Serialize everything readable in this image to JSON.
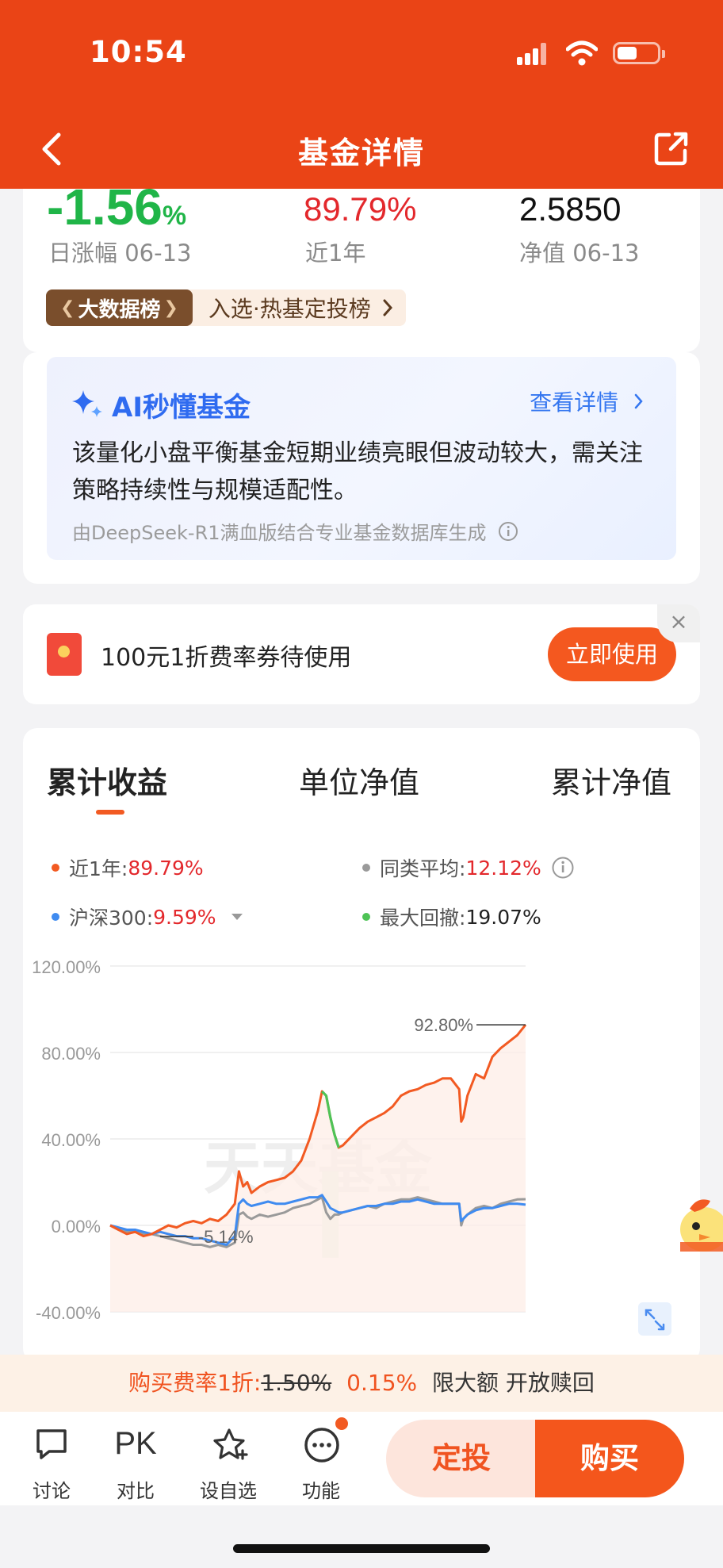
{
  "status_bar": {
    "time": "10:54"
  },
  "header": {
    "title": "基金详情"
  },
  "summary": {
    "daily_change": {
      "value": "-1.56",
      "unit": "%",
      "label": "日涨幅 06-13"
    },
    "one_year": {
      "value": "89.79%",
      "label": "近1年"
    },
    "nav": {
      "value": "2.5850",
      "label": "净值 06-13"
    },
    "rank_tag": "大数据榜",
    "rank_text": "入选·热基定投榜"
  },
  "ai": {
    "title": "AI秒懂基金",
    "more": "查看详情",
    "text": "该量化小盘平衡基金短期业绩亮眼但波动较大，需关注策略持续性与规模适配性。",
    "source": "由DeepSeek-R1满血版结合专业基金数据库生成"
  },
  "coupon": {
    "text": "100元1折费率券待使用",
    "button": "立即使用",
    "close": "×"
  },
  "tabs": [
    {
      "label": "累计收益"
    },
    {
      "label": "单位净值"
    },
    {
      "label": "累计净值"
    }
  ],
  "legend": {
    "fund": {
      "label": "近1年:",
      "value": "89.79%"
    },
    "category_avg": {
      "label": "同类平均:",
      "value": "12.12%"
    },
    "index": {
      "label": "沪深300:",
      "value": "9.59%"
    },
    "max_drawdown": {
      "label": "最大回撤:",
      "value": "19.07%"
    }
  },
  "chart_data": {
    "type": "line",
    "y_ticks": [
      "120.00%",
      "80.00%",
      "40.00%",
      "0.00%",
      "-40.00%"
    ],
    "ylim": [
      -40,
      120
    ],
    "annotations": {
      "max": "92.80%",
      "min": "-5.14%"
    },
    "watermark": "天天基金",
    "x": [
      0,
      2,
      4,
      6,
      8,
      10,
      12,
      14,
      16,
      18,
      20,
      22,
      24,
      26,
      28,
      30,
      31,
      32,
      33,
      34,
      36,
      38,
      40,
      42,
      44,
      46,
      48,
      50,
      51,
      52,
      53,
      54,
      55,
      56,
      58,
      60,
      62,
      64,
      66,
      68,
      70,
      72,
      74,
      76,
      78,
      80,
      82,
      84,
      84.5,
      85,
      86,
      88,
      90,
      92,
      94,
      96,
      98,
      100
    ],
    "series": [
      {
        "name": "近1年",
        "color": "#f25a22",
        "values": [
          0,
          -2,
          -4,
          -3,
          -5,
          -4,
          -2,
          0,
          -1,
          1,
          2,
          1,
          3,
          2,
          5,
          10,
          25,
          18,
          20,
          15,
          18,
          20,
          21,
          22,
          25,
          30,
          40,
          53,
          62,
          60,
          50,
          42,
          36,
          37,
          41,
          45,
          48,
          50,
          52,
          55,
          60,
          62,
          63,
          65,
          66,
          68,
          68,
          63,
          48,
          50,
          60,
          70,
          68,
          78,
          82,
          85,
          88,
          92.8
        ]
      },
      {
        "name": "同类平均",
        "color": "#9a9a9a",
        "values": [
          0,
          -2,
          -3,
          -3,
          -4,
          -4,
          -5,
          -6,
          -7,
          -8,
          -9,
          -9,
          -10,
          -9,
          -10,
          -8,
          5,
          6,
          4,
          3,
          5,
          4,
          5,
          6,
          8,
          9,
          10,
          12,
          13,
          6,
          3,
          5,
          5,
          6,
          7,
          8,
          9,
          8,
          10,
          11,
          12,
          12,
          13,
          12,
          11,
          10,
          10,
          10,
          0,
          3,
          5,
          8,
          9,
          8,
          10,
          11,
          12,
          12.12
        ]
      },
      {
        "name": "沪深300",
        "color": "#3f8bf0",
        "values": [
          0,
          -1,
          -2,
          -2,
          -3,
          -4,
          -3,
          -4,
          -5,
          -5,
          -6,
          -6,
          -7,
          -8,
          -9,
          -5,
          10,
          12,
          10,
          9,
          10,
          11,
          10,
          10,
          11,
          12,
          13,
          13,
          14,
          11,
          8,
          7,
          6,
          6,
          7,
          8,
          9,
          9,
          10,
          10,
          11,
          11,
          12,
          11,
          10,
          10,
          10,
          10,
          2,
          3,
          5,
          7,
          8,
          8,
          9,
          10,
          10,
          9.59
        ]
      }
    ]
  },
  "fee_bar": {
    "prefix": "购买费率1折:",
    "old": "1.50%",
    "new": "0.15%",
    "suffix": "限大额 开放赎回"
  },
  "bottom_nav": {
    "discuss": "讨论",
    "compare_icon": "PK",
    "compare": "对比",
    "watchlist": "设自选",
    "functions": "功能",
    "fixed_invest": "定投",
    "buy": "购买"
  }
}
